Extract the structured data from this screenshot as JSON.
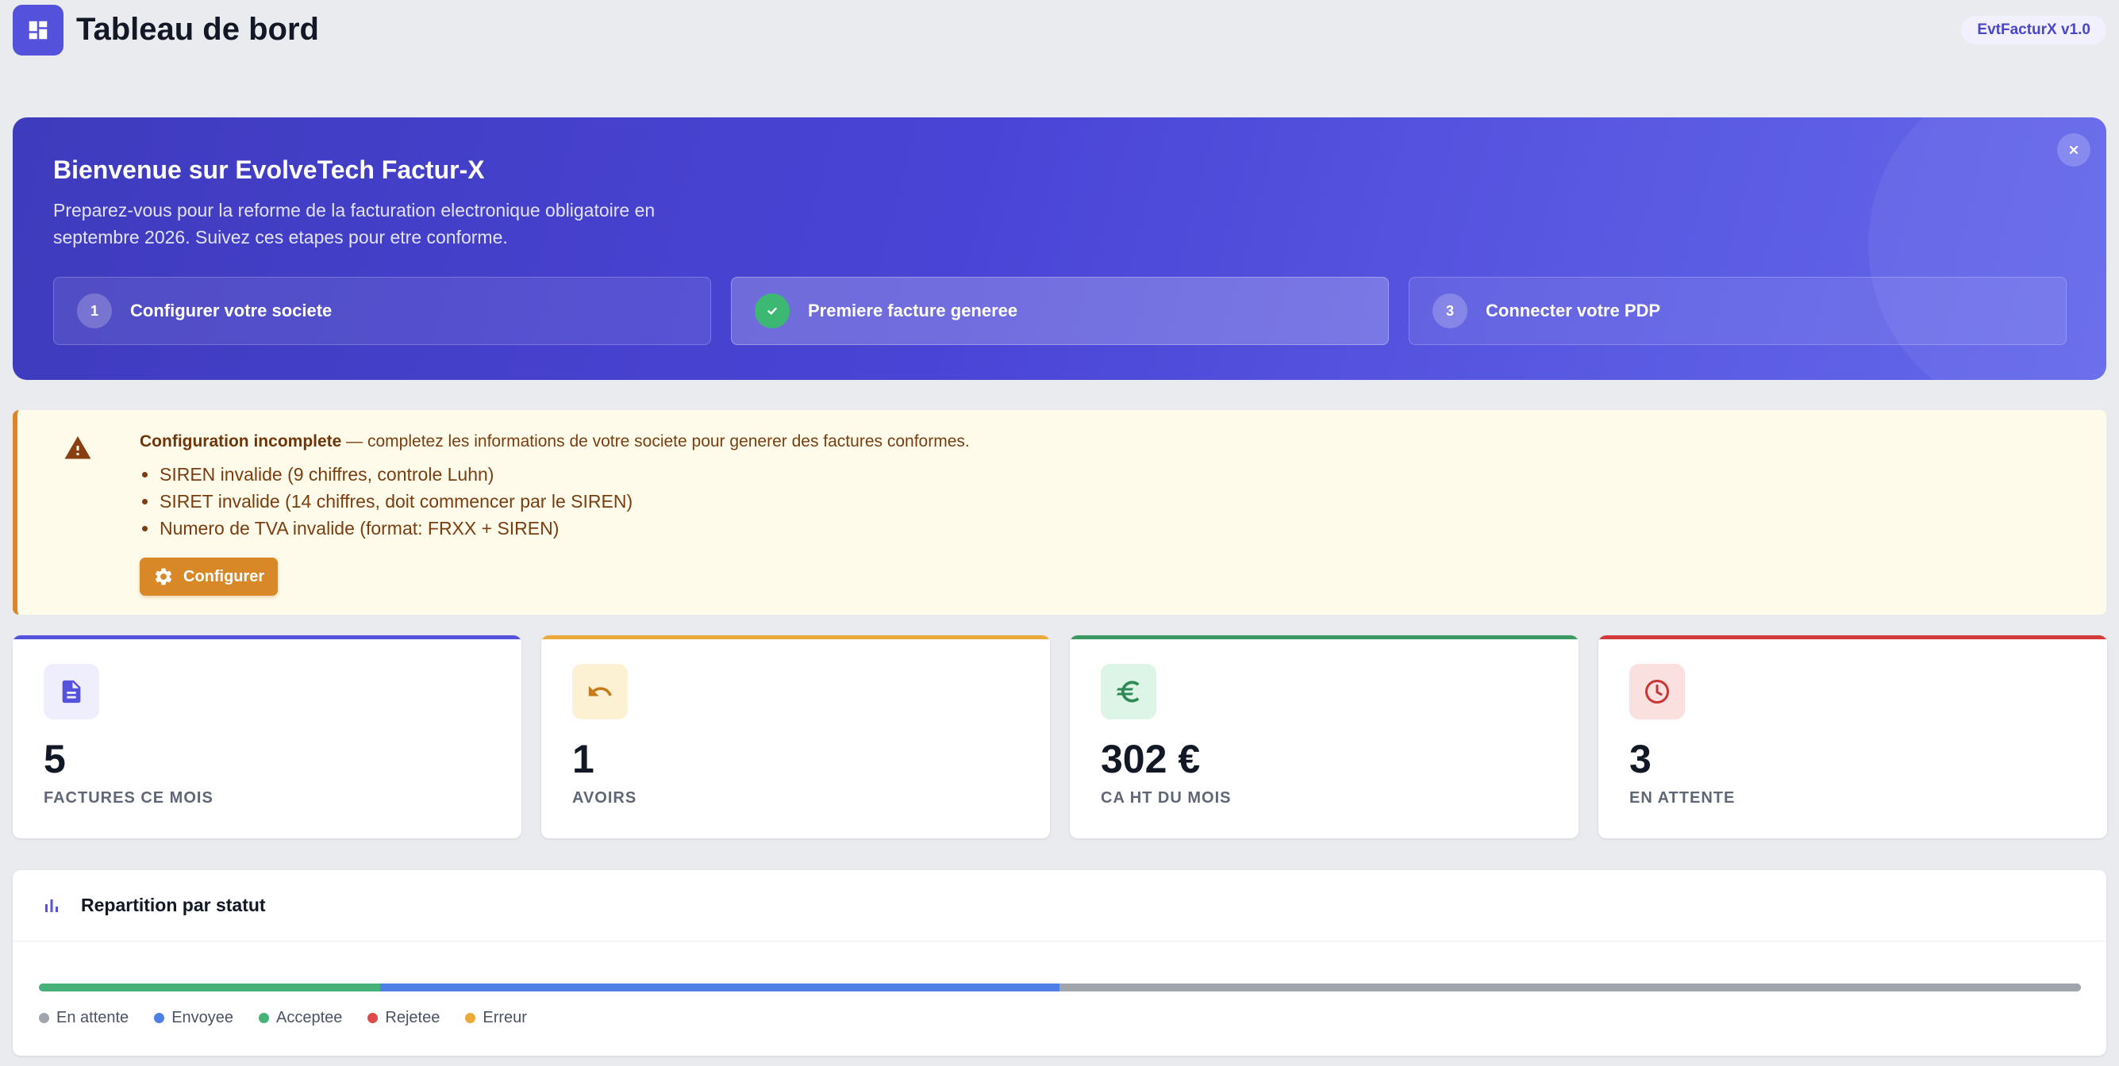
{
  "header": {
    "title": "Tableau de bord",
    "logo_icon": "dashboard-grid-icon",
    "version": "EvtFacturX v1.0"
  },
  "welcome": {
    "title": "Bienvenue sur EvolveTech Factur-X",
    "description": "Preparez-vous pour la reforme de la facturation electronique obligatoire en septembre 2026. Suivez ces etapes pour etre conforme.",
    "close_icon": "close-icon",
    "steps": [
      {
        "number": "1",
        "label": "Configurer votre societe",
        "done": false
      },
      {
        "number": "",
        "label": "Premiere facture generee",
        "done": true
      },
      {
        "number": "3",
        "label": "Connecter votre PDP",
        "done": false
      }
    ]
  },
  "alert": {
    "icon": "warning-triangle-icon",
    "title": "Configuration incomplete",
    "message": " — completez les informations de votre societe pour generer des factures conformes.",
    "items": [
      "SIREN invalide (9 chiffres, controle Luhn)",
      "SIRET invalide (14 chiffres, doit commencer par le SIREN)",
      "Numero de TVA invalide (format: FRXX + SIREN)"
    ],
    "button_label": "Configurer",
    "button_icon": "gear-icon"
  },
  "stats": [
    {
      "value": "5",
      "label": "FACTURES CE MOIS",
      "icon": "document-icon",
      "accent": "#5552dd",
      "icon_bg": "#eeeefc"
    },
    {
      "value": "1",
      "label": "AVOIRS",
      "icon": "undo-arrow-icon",
      "accent": "#eba93a",
      "icon_bg": "#fcf1d2"
    },
    {
      "value": "302 €",
      "label": "CA HT DU MOIS",
      "icon": "euro-icon",
      "accent": "#3b9a62",
      "icon_bg": "#dcf5e7"
    },
    {
      "value": "3",
      "label": "EN ATTENTE",
      "icon": "clock-icon",
      "accent": "#d33b3b",
      "icon_bg": "#fbe0e0"
    }
  ],
  "status_panel": {
    "title": "Repartition par statut",
    "icon": "bar-chart-icon",
    "segments": [
      {
        "status": "Acceptee",
        "fraction": 0.167,
        "color": "#46b27a"
      },
      {
        "status": "Envoyee",
        "fraction": 0.333,
        "color": "#4e7fe6"
      },
      {
        "status": "En attente",
        "fraction": 0.5,
        "color": "#a0a4ad"
      }
    ],
    "legend": [
      {
        "label": "En attente",
        "color": "#a0a4ad"
      },
      {
        "label": "Envoyee",
        "color": "#4e7fe6"
      },
      {
        "label": "Acceptee",
        "color": "#46b27a"
      },
      {
        "label": "Rejetee",
        "color": "#dd4a4a"
      },
      {
        "label": "Erreur",
        "color": "#eba93a"
      }
    ]
  }
}
